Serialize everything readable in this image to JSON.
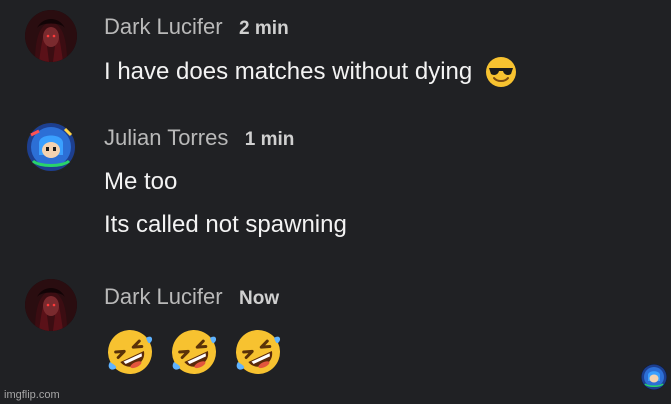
{
  "comments": [
    {
      "author": "Dark Lucifer",
      "time": "2 min",
      "avatar_icon": "dark-anime-avatar-icon",
      "lines": [
        "I have does matches without dying"
      ],
      "trailing_emoji": "smiling-face-with-sunglasses-icon"
    },
    {
      "author": "Julian Torres",
      "time": "1 min",
      "avatar_icon": "megaman-avatar-icon",
      "lines": [
        "Me too",
        "Its called not spawning"
      ]
    },
    {
      "author": "Dark Lucifer",
      "time": "Now",
      "avatar_icon": "dark-anime-avatar-icon",
      "emojis": [
        "rolling-on-floor-laughing-icon",
        "rolling-on-floor-laughing-icon",
        "rolling-on-floor-laughing-icon"
      ]
    }
  ],
  "watermark": "imgflip.com",
  "colors": {
    "background": "#202124",
    "author_text": "#b9b9b9",
    "message_text": "#f3f3f3",
    "emoji_yellow": "#f7c230"
  }
}
